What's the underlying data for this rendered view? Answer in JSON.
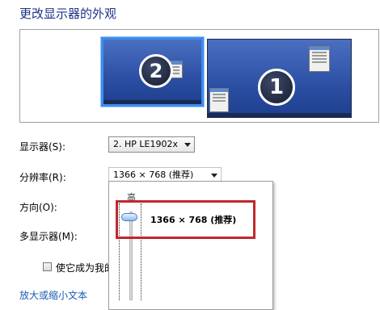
{
  "page": {
    "heading": "更改显示器的外观"
  },
  "preview": {
    "monitors": [
      {
        "number": "2",
        "selected": true
      },
      {
        "number": "1",
        "selected": false
      }
    ]
  },
  "display": {
    "label": "显示器(S):",
    "value": "2. HP LE1902x"
  },
  "resolution": {
    "label": "分辨率(R):",
    "value": "1366 × 768 (推荐)",
    "slider_top_label": "高",
    "slider_value": "1366 × 768 (推荐)",
    "slider_level": 1.0
  },
  "orientation": {
    "label": "方向(O):"
  },
  "multiple_displays": {
    "label": "多显示器(M):"
  },
  "primary_checkbox": {
    "label": "使它成为我的",
    "checked": false
  },
  "text_size_link": {
    "label": "放大或缩小文本"
  },
  "colors": {
    "highlight": "#c0282d",
    "link": "#1a5bb5",
    "heading": "#1e3287"
  }
}
